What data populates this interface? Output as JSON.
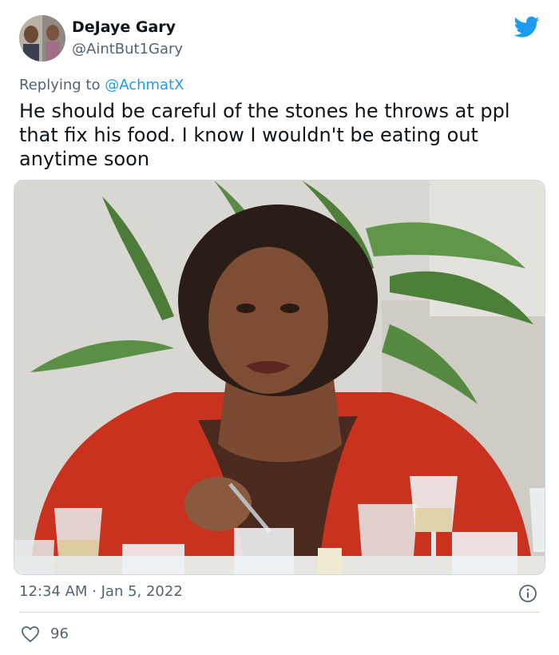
{
  "author": {
    "display_name": "DeJaye Gary",
    "handle": "@AintBut1Gary"
  },
  "reply": {
    "prefix": "Replying to ",
    "mention": "@AchmatX"
  },
  "tweet_text": "He should be careful of the stones he throws at ppl\nthat fix his food. I know I wouldn't be eating out\nanytime soon",
  "timestamp": "12:34 AM · Jan 5, 2022",
  "like_count": "96",
  "icons": {
    "brand": "twitter-bird-icon",
    "info": "info-icon",
    "like": "heart-icon"
  },
  "colors": {
    "accent": "#1d9bf0",
    "muted": "#536471",
    "text": "#0f1419"
  }
}
